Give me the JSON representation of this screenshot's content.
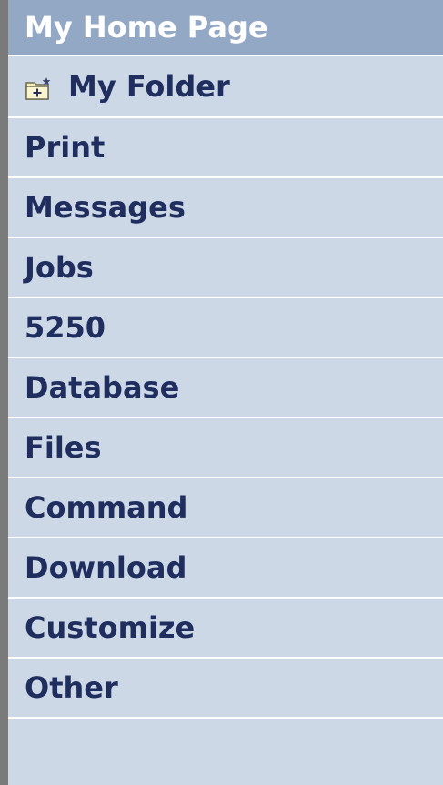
{
  "nav": {
    "header": "My Home Page",
    "folder": {
      "label": "My Folder",
      "icon": "new-folder-icon"
    },
    "items": [
      "Print",
      "Messages",
      "Jobs",
      "5250",
      "Database",
      "Files",
      "Command",
      "Download",
      "Customize",
      "Other"
    ]
  },
  "colors": {
    "header_bg": "#93a8c5",
    "menu_bg": "#cdd8e6",
    "text": "#1f2e5e",
    "divider": "#ffffff",
    "left_border": "#7a7a7a"
  }
}
